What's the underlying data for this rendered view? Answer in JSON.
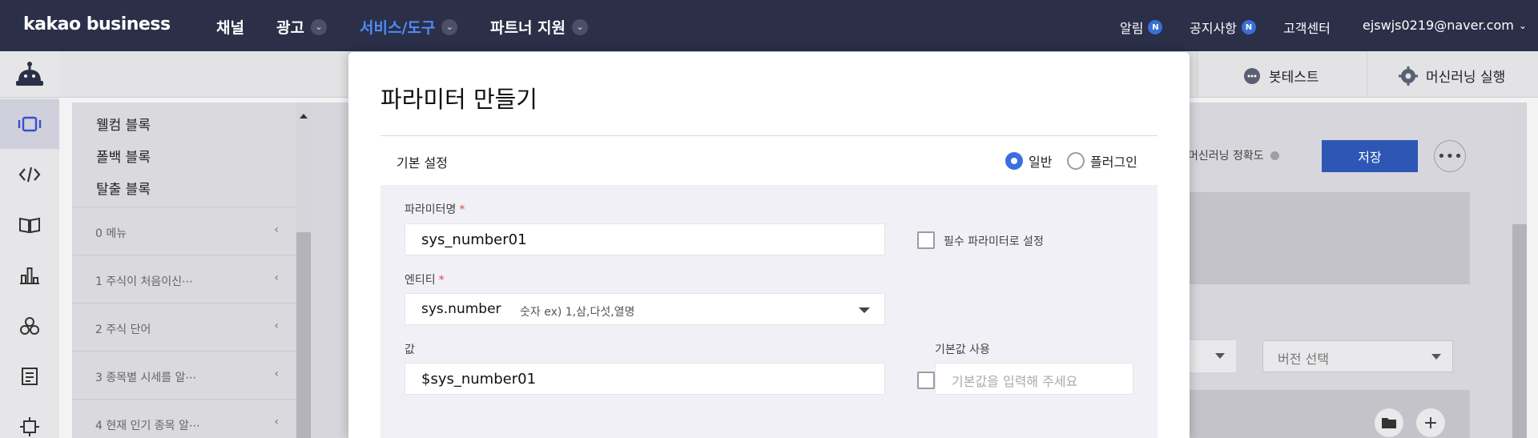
{
  "topnav": {
    "logo": "kakao business",
    "menu": [
      {
        "label": "채널",
        "has_dropdown": false,
        "active": false
      },
      {
        "label": "광고",
        "has_dropdown": true,
        "active": false
      },
      {
        "label": "서비스/도구",
        "has_dropdown": true,
        "active": true
      },
      {
        "label": "파트너 지원",
        "has_dropdown": true,
        "active": false
      }
    ],
    "right": {
      "alarm": "알림",
      "notice": "공지사항",
      "badge": "N",
      "support": "고객센터",
      "account": "ejswjs0219@naver.com"
    }
  },
  "toolbar": {
    "bot_test": "봇테스트",
    "ml_run": "머신러닝 실행"
  },
  "rail_icons": [
    "bot-avatar-icon",
    "scenario-icon",
    "code-icon",
    "book-icon",
    "chart-icon",
    "entity-icon",
    "form-icon",
    "settings-icon"
  ],
  "blocks": {
    "items": [
      "웰컴 블록",
      "폴백 블록",
      "탈출 블록"
    ],
    "scenarios": [
      "0 메뉴",
      "1 주식이 처음이신⋯",
      "2 주식 단어",
      "3 종목별 시세를 알⋯",
      "4 현재 인기 종목 알⋯"
    ]
  },
  "background": {
    "accuracy_label": "머신러닝 정확도",
    "save_label": "저장",
    "more_label": "•••",
    "version_select": "버전 선택",
    "accent": "#2e56b5"
  },
  "modal": {
    "title": "파라미터 만들기",
    "section_label": "기본 설정",
    "radio_general": "일반",
    "radio_plugin": "플러그인",
    "param_name_label": "파라미터명",
    "required_mark": "*",
    "param_name_value": "sys_number01",
    "required_checkbox_label": "필수 파라미터로 설정",
    "entity_label": "엔티티",
    "entity_value": "sys.number",
    "entity_hint": "숫자 ex) 1,삼,다섯,열명",
    "value_label": "값",
    "value_value": "$sys_number01",
    "default_label": "기본값 사용",
    "default_placeholder": "기본값을 입력해 주세요",
    "radio_color": "#3c6fe0"
  }
}
